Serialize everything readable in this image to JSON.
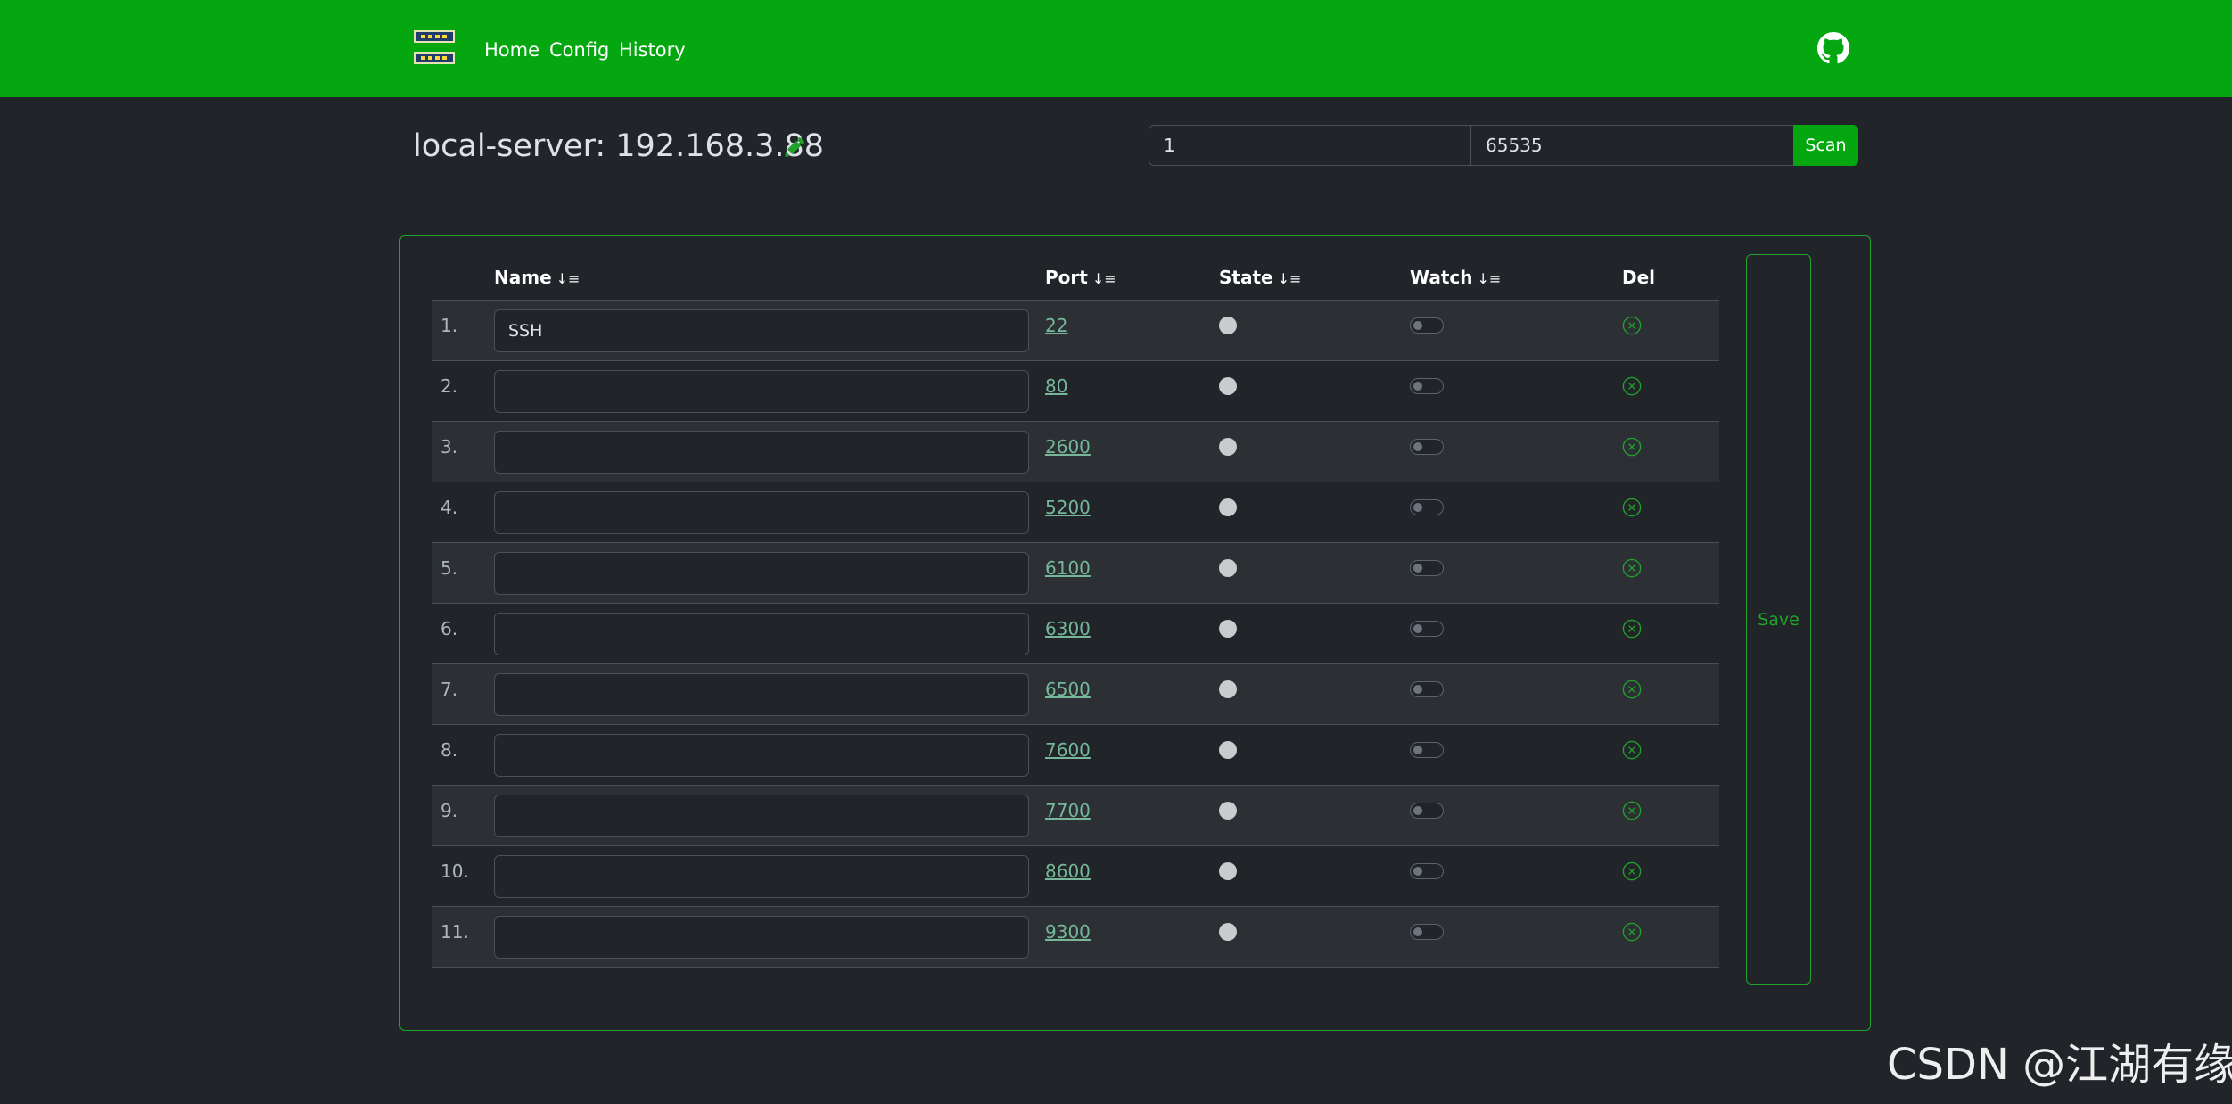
{
  "nav": {
    "links": [
      "Home",
      "Config",
      "History"
    ]
  },
  "icons": {
    "logo": "server-logo-icon",
    "github": "github-icon",
    "edit": "pencil-icon",
    "sort": "sort-icon",
    "state": "state-dot-icon",
    "delete": "circle-x-icon"
  },
  "colors": {
    "brand": "#04a70f",
    "background": "#212529",
    "link": "#75b798",
    "border": "#21a32b"
  },
  "server": {
    "title": "local-server: 192.168.3.88"
  },
  "scan": {
    "start_value": "1",
    "end_value": "65535",
    "button_label": "Scan"
  },
  "table": {
    "headers": {
      "name": "Name",
      "port": "Port",
      "state": "State",
      "watch": "Watch",
      "del": "Del"
    },
    "sort_glyph": "↓≡",
    "rows": [
      {
        "index": "1.",
        "name": "SSH",
        "port": "22",
        "watch": false
      },
      {
        "index": "2.",
        "name": "",
        "port": "80",
        "watch": false
      },
      {
        "index": "3.",
        "name": "",
        "port": "2600",
        "watch": false
      },
      {
        "index": "4.",
        "name": "",
        "port": "5200",
        "watch": false
      },
      {
        "index": "5.",
        "name": "",
        "port": "6100",
        "watch": false
      },
      {
        "index": "6.",
        "name": "",
        "port": "6300",
        "watch": false
      },
      {
        "index": "7.",
        "name": "",
        "port": "6500",
        "watch": false
      },
      {
        "index": "8.",
        "name": "",
        "port": "7600",
        "watch": false
      },
      {
        "index": "9.",
        "name": "",
        "port": "7700",
        "watch": false
      },
      {
        "index": "10.",
        "name": "",
        "port": "8600",
        "watch": false
      },
      {
        "index": "11.",
        "name": "",
        "port": "9300",
        "watch": false
      }
    ]
  },
  "save_label": "Save",
  "watermark": "CSDN @江湖有缘"
}
